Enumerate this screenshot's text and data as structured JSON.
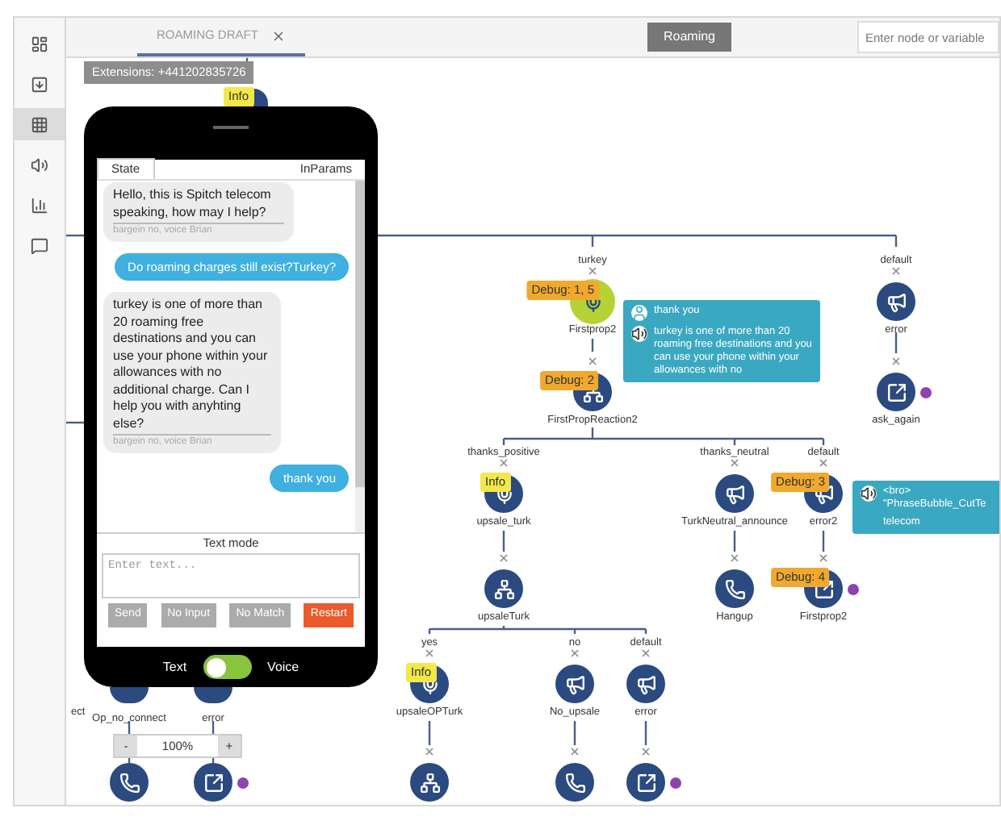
{
  "sidebar": {
    "items": [
      {
        "selected": false
      },
      {
        "selected": false
      },
      {
        "selected": true
      },
      {
        "selected": false
      },
      {
        "selected": false
      },
      {
        "selected": false
      }
    ]
  },
  "tabs": [
    {
      "label": "ROAMING DRAFT",
      "selected": true
    }
  ],
  "flow_button": "Roaming",
  "search": {
    "placeholder": "Enter node or variable"
  },
  "tooltip": "Extensions: +441202835726",
  "nodes": [
    {
      "kind": "unknown",
      "active": false,
      "tag": {
        "kind": "info",
        "text": "Info"
      }
    },
    {
      "kind": "mic",
      "active": true,
      "branch": "turkey",
      "label": "Firstprop2",
      "tag": {
        "kind": "debug",
        "text": "Debug: 1, 5"
      }
    },
    {
      "kind": "split",
      "active": false,
      "label": "FirstPropReaction2",
      "tag": {
        "kind": "debug",
        "text": "Debug: 2"
      }
    },
    {
      "kind": "announce",
      "active": false,
      "branch": "default",
      "label": "error"
    },
    {
      "kind": "goto",
      "active": false,
      "label": "ask_again",
      "color": "#8e44ad"
    },
    {
      "kind": "mic",
      "active": false,
      "branch": "thanks_positive",
      "label": "upsale_turk",
      "tag": {
        "kind": "info",
        "text": "Info"
      }
    },
    {
      "kind": "split",
      "active": false,
      "label": "upsaleTurk"
    },
    {
      "kind": "announce",
      "active": false,
      "branch": "thanks_neutral",
      "label": "TurkNeutral_announce"
    },
    {
      "kind": "hangup",
      "active": false,
      "label": "Hangup"
    },
    {
      "kind": "announce",
      "active": false,
      "branch": "default",
      "label": "error2",
      "tag": {
        "kind": "debug",
        "text": "Debug: 3"
      }
    },
    {
      "kind": "goto",
      "active": false,
      "label": "Firstprop2",
      "color": "#8e44ad",
      "tag": {
        "kind": "debug",
        "text": "Debug: 4"
      }
    },
    {
      "kind": "mic",
      "active": false,
      "branch": "yes",
      "label": "upsaleOPTurk",
      "tag": {
        "kind": "info",
        "text": "Info"
      }
    },
    {
      "kind": "split",
      "active": false
    },
    {
      "kind": "announce",
      "active": false,
      "branch": "no",
      "label": "No_upsale"
    },
    {
      "kind": "hangup",
      "active": false
    },
    {
      "kind": "announce",
      "active": false,
      "branch": "default",
      "label": "error"
    },
    {
      "kind": "goto",
      "active": false,
      "color": "#8e44ad"
    },
    {
      "kind": "unknown",
      "active": false,
      "label": "Op_no_connect"
    },
    {
      "kind": "unknown",
      "active": false,
      "label": "error"
    },
    {
      "kind": "hangup",
      "active": false
    },
    {
      "kind": "goto",
      "active": false,
      "color": "#8e44ad"
    }
  ],
  "fragment_label": "ect",
  "bubbles": [
    {
      "lines": [
        {
          "kind": "user",
          "text": "thank you"
        },
        {
          "kind": "speaker",
          "text": "turkey is one of more than 20 roaming free destinations and you can use your phone within your allowances with no"
        }
      ]
    },
    {
      "lines": [
        {
          "kind": "speaker",
          "text": "<bro> \"PhraseBubble_CutTe"
        },
        {
          "kind": "plain",
          "text": "telecom"
        }
      ]
    }
  ],
  "zoom": {
    "minus": "-",
    "value": "100%",
    "plus": "+"
  },
  "phone": {
    "tabs": [
      {
        "label": "State",
        "selected": true
      },
      {
        "label": "InParams",
        "selected": false
      }
    ],
    "messages": [
      {
        "kind": "bot",
        "text": "Hello, this is Spitch telecom speaking, how may I help?",
        "meta": "bargein no, voice Brian"
      },
      {
        "kind": "user",
        "text": "Do roaming charges still exist?Turkey?"
      },
      {
        "kind": "bot",
        "text": "turkey is one of more than 20 roaming free destinations and you can use your phone within your allowances with no additional charge. Can I help you with anyhting else?",
        "meta": "bargein no, voice Brian"
      },
      {
        "kind": "user",
        "text": "thank you"
      }
    ],
    "mode_title": "Text mode",
    "input": {
      "placeholder": "Enter text..."
    },
    "buttons": [
      {
        "label": "Send",
        "kind": "plain",
        "disabled": true
      },
      {
        "label": "No Input",
        "kind": "plain",
        "disabled": true
      },
      {
        "label": "No Match",
        "kind": "plain",
        "disabled": true
      },
      {
        "label": "Restart",
        "kind": "danger",
        "disabled": false
      }
    ],
    "toggle": {
      "left": "Text",
      "right": "Voice",
      "on": false
    }
  }
}
